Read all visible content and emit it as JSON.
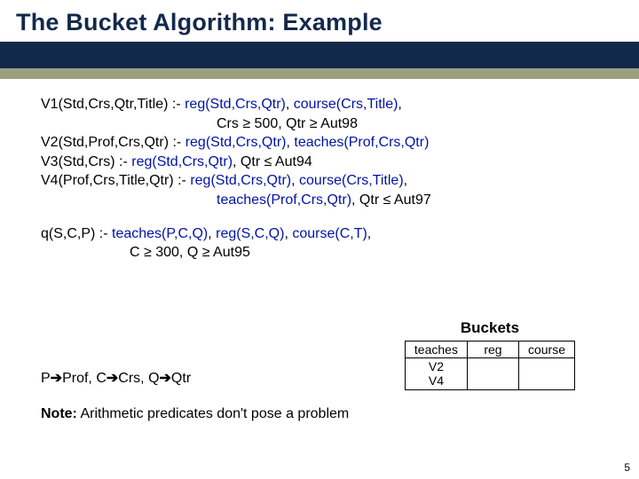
{
  "title": "The Bucket Algorithm: Example",
  "views": {
    "v1_head": "V1(Std,Crs,Qtr,Title) :- ",
    "v1_reg": "reg(Std,Crs,Qtr)",
    "v1_mid": ", ",
    "v1_course": "course(Crs,Title)",
    "v1_tail": ",",
    "v1_cond": "Crs ≥ 500, Qtr ≥ Aut98",
    "v2_head": "V2(Std,Prof,Crs,Qtr) :- ",
    "v2_reg": "reg(Std,Crs,Qtr)",
    "v2_mid": ", ",
    "v2_teach": "teaches(Prof,Crs,Qtr)",
    "v3_head": "V3(Std,Crs) :- ",
    "v3_reg": "reg(Std,Crs,Qtr)",
    "v3_tail": ", Qtr ≤ Aut94",
    "v4_head": "V4(Prof,Crs,Title,Qtr) :- ",
    "v4_reg": "reg(Std,Crs,Qtr)",
    "v4_mid": ", ",
    "v4_course": "course(Crs,Title)",
    "v4_tail": ",",
    "v4_teach": "teaches(Prof,Crs,Qtr)",
    "v4_cond": ", Qtr ≤ Aut97"
  },
  "query": {
    "head": "q(S,C,P) :- ",
    "teach": "teaches(P,C,Q)",
    "mid1": ", ",
    "reg": "reg(S,C,Q)",
    "mid2": ", ",
    "course": "course(C,T)",
    "tail": ",",
    "cond": "C ≥ 300, Q ≥ Aut95"
  },
  "buckets": {
    "label": "Buckets",
    "headers": {
      "h1": "teaches",
      "h2": "reg",
      "h3": "course"
    },
    "col1_l1": "V2",
    "col1_l2": "V4"
  },
  "subst": {
    "p_from": "P",
    "p_to": "Prof,  ",
    "c_from": "C",
    "c_to": "Crs,  ",
    "q_from": "Q",
    "q_to": "Qtr"
  },
  "note": {
    "label": "Note:",
    "text": " Arithmetic predicates don't pose a problem"
  },
  "page_num": "5"
}
